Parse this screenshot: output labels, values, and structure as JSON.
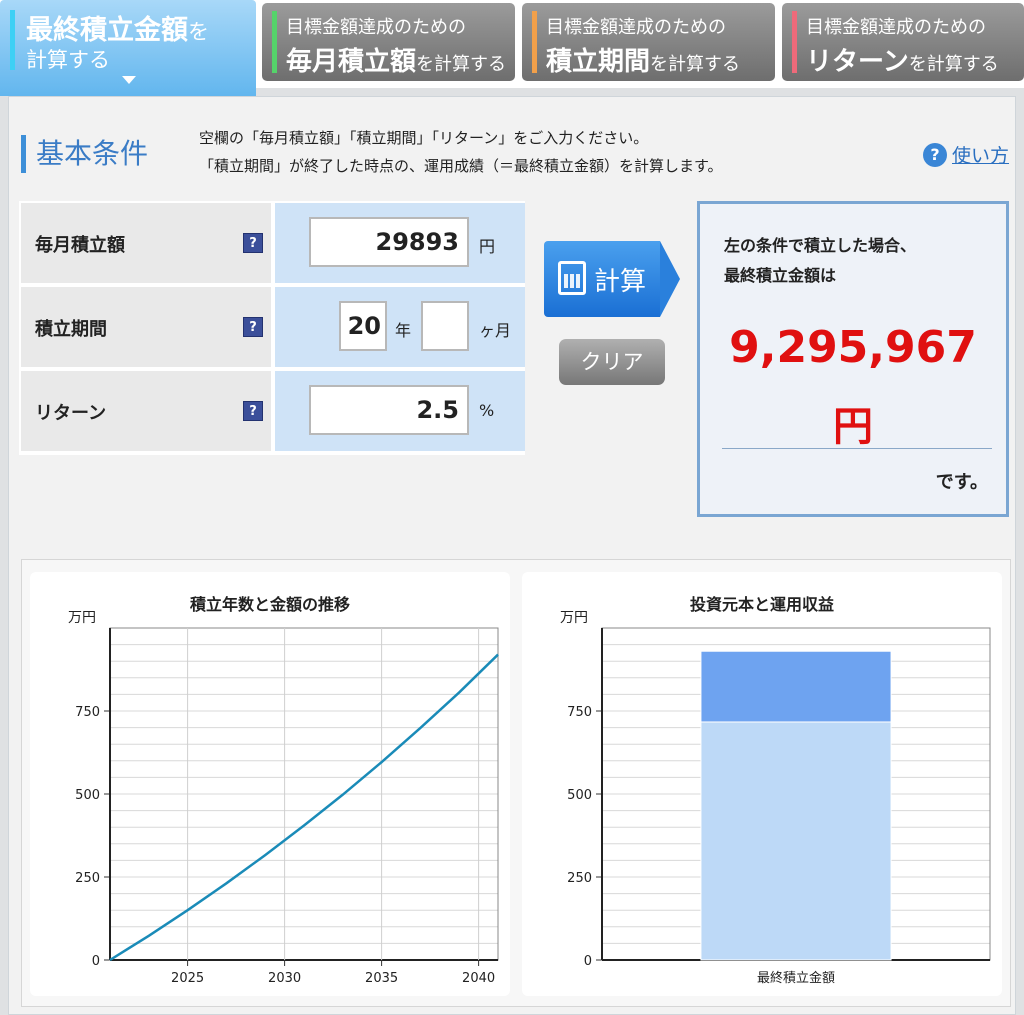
{
  "tabs": [
    {
      "line1": "最終積立金額",
      "line1_suffix": "を",
      "line2": "計算する",
      "active": true
    },
    {
      "line1": "目標金額達成のための",
      "line2": "毎月積立額",
      "line2_suffix": "を計算する",
      "accent": "#55d36a"
    },
    {
      "line1": "目標金額達成のための",
      "line2": "積立期間",
      "line2_suffix": "を計算する",
      "accent": "#f2a04a"
    },
    {
      "line1": "目標金額達成のための",
      "line2": "リターン",
      "line2_suffix": "を計算する",
      "accent": "#ee6a7a"
    }
  ],
  "section": {
    "title": "基本条件",
    "desc1": "空欄の「毎月積立額」「積立期間」「リターン」をご入力ください。",
    "desc2": "「積立期間」が終了した時点の、運用成績（＝最終積立金額）を計算します。",
    "help_icon": "question-icon",
    "help_text": "使い方"
  },
  "form": {
    "monthly": {
      "label": "毎月積立額",
      "value": "29893",
      "unit": "円"
    },
    "period": {
      "label": "積立期間",
      "years": "20",
      "years_unit": "年",
      "months": "",
      "months_unit": "ヶ月"
    },
    "return": {
      "label": "リターン",
      "value": "2.5",
      "unit": "%"
    },
    "help_mark": "?"
  },
  "buttons": {
    "calc": "計算",
    "clear": "クリア"
  },
  "result": {
    "line1": "左の条件で積立した場合、",
    "line2": "最終積立金額は",
    "amount": "9,295,967",
    "yen": "円",
    "desu": "です。"
  },
  "chart_data": [
    {
      "type": "line",
      "title": "積立年数と金額の推移",
      "ylabel": "万円",
      "x": [
        2021,
        2023,
        2025,
        2027,
        2029,
        2031,
        2033,
        2035,
        2037,
        2039,
        2041
      ],
      "series": [
        {
          "values": [
            0,
            73,
            150,
            231,
            316,
            405,
            498,
            596,
            699,
            806,
            920
          ]
        }
      ],
      "xticks": [
        2025,
        2030,
        2035,
        2040
      ],
      "yticks": [
        0,
        250,
        500,
        750
      ],
      "xlim": [
        2021,
        2041
      ],
      "ylim": [
        0,
        1000
      ],
      "color": "#1a8bb8",
      "grid": true
    },
    {
      "type": "bar",
      "title": "投資元本と運用収益",
      "ylabel": "万円",
      "categories": [
        "最終積立金額"
      ],
      "series": [
        {
          "values": [
            717
          ]
        },
        {
          "values": [
            213
          ]
        }
      ],
      "yticks": [
        0,
        250,
        500,
        750
      ],
      "ylim": [
        0,
        1000
      ],
      "colors": [
        "#bdd9f7",
        "#6ea3f0"
      ],
      "grid": true
    }
  ]
}
